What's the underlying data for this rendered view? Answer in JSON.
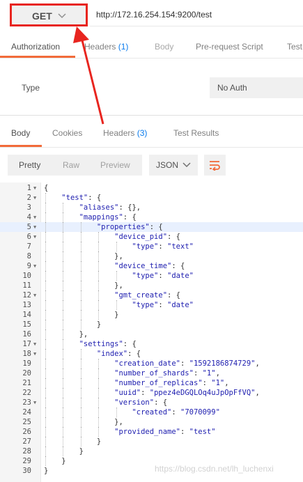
{
  "request": {
    "method": "GET",
    "url": "http://172.16.254.154:9200/test"
  },
  "request_tabs": [
    {
      "label": "Authorization",
      "count": "",
      "state": "active"
    },
    {
      "label": "Headers",
      "count": "(1)",
      "state": "normal"
    },
    {
      "label": "Body",
      "count": "",
      "state": "dim"
    },
    {
      "label": "Pre-request Script",
      "count": "",
      "state": "normal"
    },
    {
      "label": "Test",
      "count": "",
      "state": "normal"
    }
  ],
  "auth": {
    "type_label": "Type",
    "type_value": "No Auth"
  },
  "response_tabs": [
    {
      "label": "Body",
      "count": "",
      "state": "active"
    },
    {
      "label": "Cookies",
      "count": "",
      "state": "normal"
    },
    {
      "label": "Headers",
      "count": "(3)",
      "state": "normal"
    },
    {
      "label": "Test Results",
      "count": "",
      "state": "normal"
    }
  ],
  "view_modes": {
    "options": [
      "Pretty",
      "Raw",
      "Preview"
    ],
    "selected": "Pretty"
  },
  "format": "JSON",
  "icons": {
    "method_dropdown": "chevron-down-icon",
    "format_dropdown": "chevron-down-icon",
    "wrap": "wrap-lines-icon"
  },
  "colors": {
    "accent": "#f26b3a",
    "count": "#097bed",
    "string": "#1d1daf",
    "annotation": "#e8251f"
  },
  "highlighted_line": "5",
  "code_lines": [
    {
      "num": "1",
      "fold": true,
      "text": "{"
    },
    {
      "num": "2",
      "fold": true,
      "text": "    \"test\": {"
    },
    {
      "num": "3",
      "fold": false,
      "text": "        \"aliases\": {},"
    },
    {
      "num": "4",
      "fold": true,
      "text": "        \"mappings\": {"
    },
    {
      "num": "5",
      "fold": true,
      "text": "            \"properties\": {"
    },
    {
      "num": "6",
      "fold": true,
      "text": "                \"device_pid\": {"
    },
    {
      "num": "7",
      "fold": false,
      "text": "                    \"type\": \"text\""
    },
    {
      "num": "8",
      "fold": false,
      "text": "                },"
    },
    {
      "num": "9",
      "fold": true,
      "text": "                \"device_time\": {"
    },
    {
      "num": "10",
      "fold": false,
      "text": "                    \"type\": \"date\""
    },
    {
      "num": "11",
      "fold": false,
      "text": "                },"
    },
    {
      "num": "12",
      "fold": true,
      "text": "                \"gmt_create\": {"
    },
    {
      "num": "13",
      "fold": false,
      "text": "                    \"type\": \"date\""
    },
    {
      "num": "14",
      "fold": false,
      "text": "                }"
    },
    {
      "num": "15",
      "fold": false,
      "text": "            }"
    },
    {
      "num": "16",
      "fold": false,
      "text": "        },"
    },
    {
      "num": "17",
      "fold": true,
      "text": "        \"settings\": {"
    },
    {
      "num": "18",
      "fold": true,
      "text": "            \"index\": {"
    },
    {
      "num": "19",
      "fold": false,
      "text": "                \"creation_date\": \"1592186874729\","
    },
    {
      "num": "20",
      "fold": false,
      "text": "                \"number_of_shards\": \"1\","
    },
    {
      "num": "21",
      "fold": false,
      "text": "                \"number_of_replicas\": \"1\","
    },
    {
      "num": "22",
      "fold": false,
      "text": "                \"uuid\": \"ppez4eDGQLOq4uJpOpFfVQ\","
    },
    {
      "num": "23",
      "fold": true,
      "text": "                \"version\": {"
    },
    {
      "num": "24",
      "fold": false,
      "text": "                    \"created\": \"7070099\""
    },
    {
      "num": "25",
      "fold": false,
      "text": "                },"
    },
    {
      "num": "26",
      "fold": false,
      "text": "                \"provided_name\": \"test\""
    },
    {
      "num": "27",
      "fold": false,
      "text": "            }"
    },
    {
      "num": "28",
      "fold": false,
      "text": "        }"
    },
    {
      "num": "29",
      "fold": false,
      "text": "    }"
    },
    {
      "num": "30",
      "fold": false,
      "text": "}"
    }
  ],
  "watermark": "https://blog.csdn.net/lh_luchenxi"
}
